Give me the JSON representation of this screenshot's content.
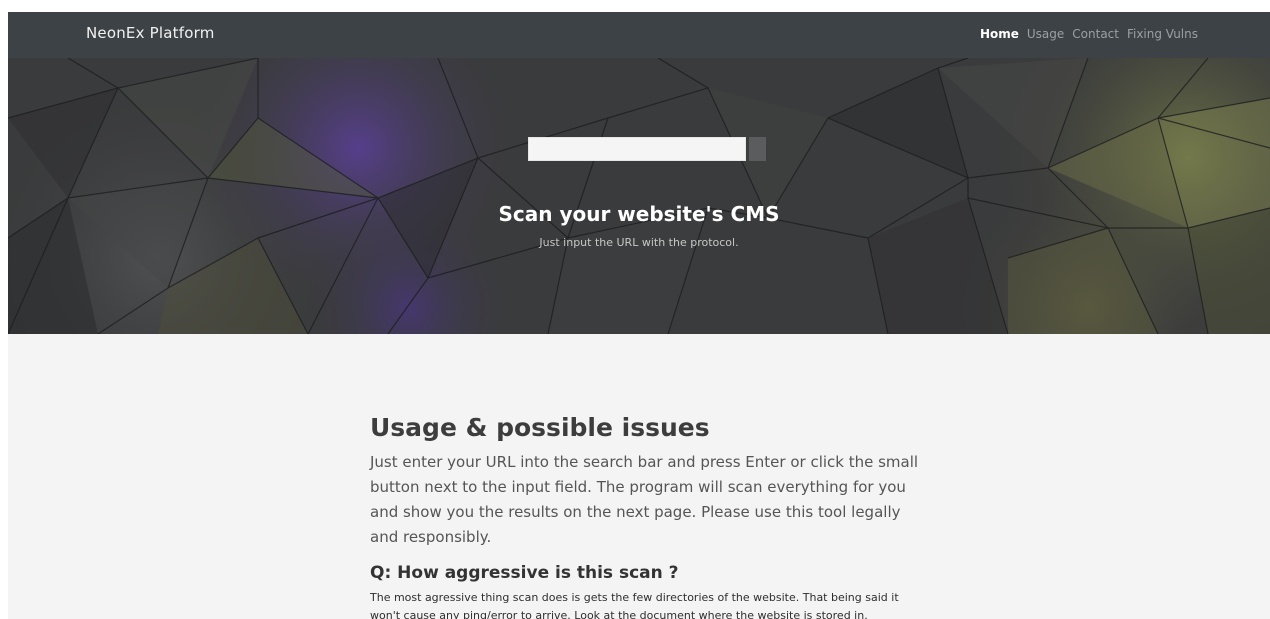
{
  "navbar": {
    "brand": "NeonEx Platform",
    "links": [
      {
        "label": "Home",
        "active": true
      },
      {
        "label": "Usage",
        "active": false
      },
      {
        "label": "Contact",
        "active": false
      },
      {
        "label": "Fixing Vulns",
        "active": false
      }
    ]
  },
  "hero": {
    "search": {
      "value": "",
      "placeholder": ""
    },
    "title": "Scan your website's CMS",
    "subtitle": "Just input the URL with the protocol."
  },
  "usage": {
    "title": "Usage & possible issues",
    "text": "Just enter your URL into the search bar and press Enter or click the small button next to the input field. The program will scan everything for you and show you the results on the next page. Please use this tool legally and responsibly.",
    "faq": [
      {
        "question": "Q: How aggressive is this scan ?",
        "answer": "The most agressive thing scan does is gets the few directories of the website. That being said it won't cause any ping/error to arrive. Look at the document where the website is stored in."
      }
    ]
  },
  "colors": {
    "navbar_bg": "#3c4245",
    "page_bg": "#f4f4f4",
    "hero_bg": "#3a3b3c"
  }
}
